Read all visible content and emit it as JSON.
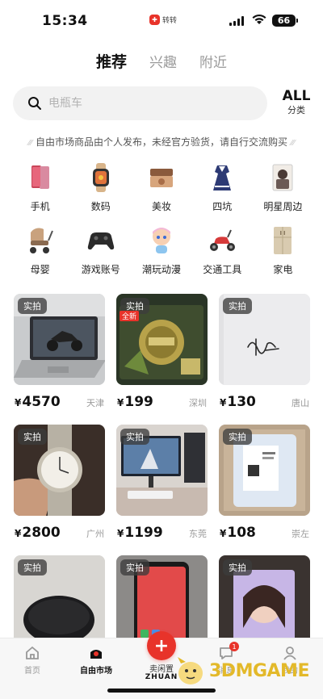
{
  "status_bar": {
    "time": "15:34",
    "app_label": "转转",
    "battery": "66"
  },
  "top_tabs": [
    {
      "label": "推荐",
      "active": true
    },
    {
      "label": "兴趣",
      "active": false
    },
    {
      "label": "附近",
      "active": false
    }
  ],
  "search": {
    "placeholder": "电瓶车",
    "all_label": "ALL",
    "category_label": "分类"
  },
  "notice": "自由市场商品由个人发布，未经官方验货，请自行交流购买",
  "categories": [
    {
      "label": "手机",
      "icon": "phone-icon"
    },
    {
      "label": "数码",
      "icon": "smartwatch-icon"
    },
    {
      "label": "美妆",
      "icon": "cosmetics-icon"
    },
    {
      "label": "四坑",
      "icon": "dress-icon"
    },
    {
      "label": "明星周边",
      "icon": "star-photo-icon"
    },
    {
      "label": "母婴",
      "icon": "stroller-icon"
    },
    {
      "label": "游戏账号",
      "icon": "gamepad-icon"
    },
    {
      "label": "潮玩动漫",
      "icon": "toy-figure-icon"
    },
    {
      "label": "交通工具",
      "icon": "scooter-icon"
    },
    {
      "label": "家电",
      "icon": "appliance-icon"
    }
  ],
  "products": [
    {
      "badge": "实拍",
      "currency": "¥",
      "price": "4570",
      "location": "天津",
      "image": "laptop-photo"
    },
    {
      "badge": "实拍",
      "currency": "¥",
      "price": "199",
      "location": "深圳",
      "image": "card-photo"
    },
    {
      "badge": "实拍",
      "currency": "¥",
      "price": "130",
      "location": "唐山",
      "image": "autograph-photo"
    },
    {
      "badge": "实拍",
      "currency": "¥",
      "price": "2800",
      "location": "广州",
      "image": "watch-photo"
    },
    {
      "badge": "实拍",
      "currency": "¥",
      "price": "1199",
      "location": "东莞",
      "image": "monitor-photo"
    },
    {
      "badge": "实拍",
      "currency": "¥",
      "price": "108",
      "location": "崇左",
      "image": "package-photo"
    },
    {
      "badge": "实拍",
      "currency": "¥",
      "price": "",
      "location": "",
      "image": "earbuds-photo"
    },
    {
      "badge": "实拍",
      "currency": "¥",
      "price": "",
      "location": "",
      "image": "redphone-photo"
    },
    {
      "badge": "实拍",
      "currency": "¥",
      "price": "",
      "location": "",
      "image": "idolcard-photo"
    }
  ],
  "card2_extra_label": "全新",
  "bottom_nav": {
    "home": "首页",
    "market": "自由市场",
    "sell": "卖闲置",
    "sell_icon": "+",
    "messages": "消息",
    "messages_badge": "1",
    "mine": "我的",
    "brand": "ZHUAN"
  },
  "watermark": "3DMGAME",
  "colors": {
    "accent": "#e8332a",
    "badge_bg": "#3c3c3c",
    "watermark": "#e3b92a"
  }
}
